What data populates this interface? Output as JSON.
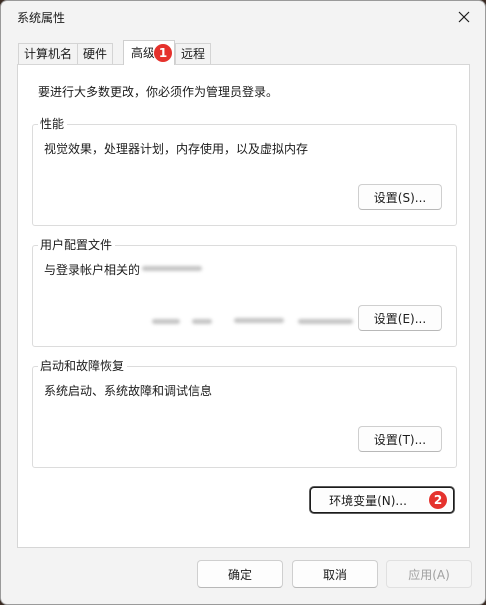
{
  "window": {
    "title": "系统属性"
  },
  "tabs": [
    {
      "label": "计算机名"
    },
    {
      "label": "硬件"
    },
    {
      "label": "高级"
    },
    {
      "label": "远程"
    }
  ],
  "panel": {
    "note": "要进行大多数更改，你必须作为管理员登录。",
    "performance": {
      "label": "性能",
      "description": "视觉效果，处理器计划，内存使用，以及虚拟内存",
      "button": "设置(S)..."
    },
    "user_profiles": {
      "label": "用户配置文件",
      "description": "与登录帐户相关的",
      "button": "设置(E)..."
    },
    "startup_recovery": {
      "label": "启动和故障恢复",
      "description": "系统启动、系统故障和调试信息",
      "button": "设置(T)..."
    },
    "env_button": "环境变量(N)..."
  },
  "footer": {
    "ok": "确定",
    "cancel": "取消",
    "apply": "应用(A)"
  },
  "markers": [
    "1",
    "2"
  ],
  "colors": {
    "marker": "#e5322d",
    "panel": "#ffffff",
    "window": "#f3f3f3"
  }
}
